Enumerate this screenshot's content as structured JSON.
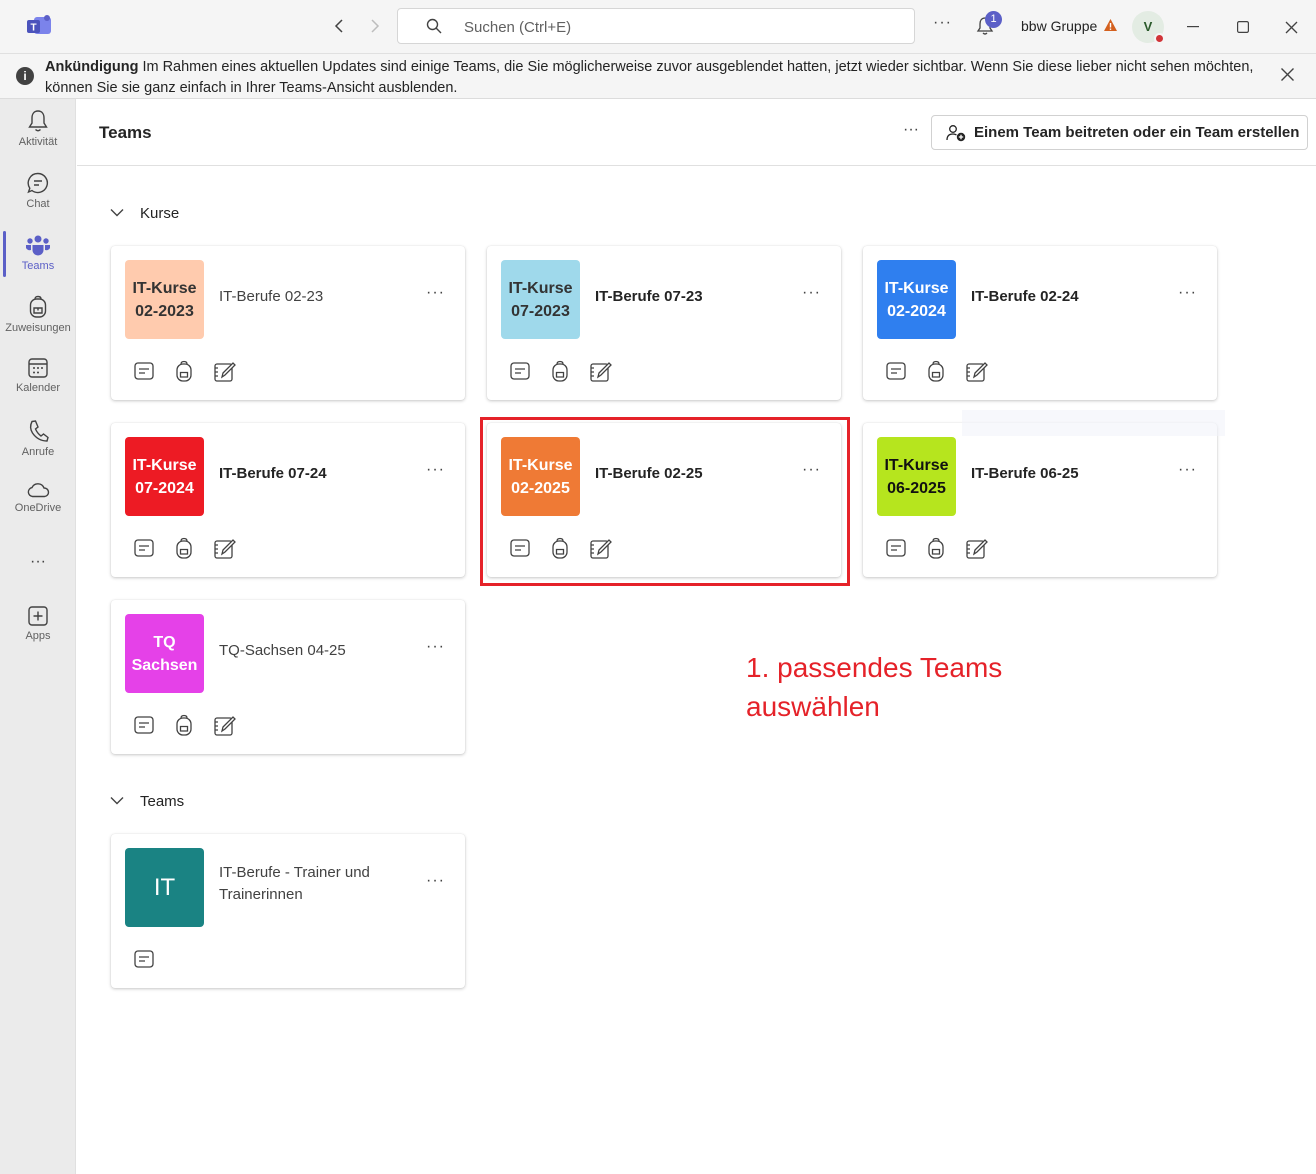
{
  "titlebar": {
    "search_placeholder": "Suchen (Ctrl+E)",
    "more": "···",
    "notification_count": "1",
    "org_name": "bbw Gruppe",
    "avatar_initial": "V"
  },
  "announcement": {
    "title": "Ankündigung",
    "text": " Im Rahmen eines aktuellen Updates sind einige Teams, die Sie möglicherweise zuvor ausgeblendet hatten, jetzt wieder sichtbar. Wenn Sie diese lieber nicht sehen möchten, können Sie sie ganz einfach in Ihrer Teams-Ansicht ausblenden."
  },
  "rail": {
    "items": [
      {
        "label": "Aktivität",
        "icon": "bell-icon"
      },
      {
        "label": "Chat",
        "icon": "chat-icon"
      },
      {
        "label": "Teams",
        "icon": "teams-icon"
      },
      {
        "label": "Zuweisungen",
        "icon": "backpack-icon"
      },
      {
        "label": "Kalender",
        "icon": "calendar-icon"
      },
      {
        "label": "Anrufe",
        "icon": "phone-icon"
      },
      {
        "label": "OneDrive",
        "icon": "cloud-icon"
      },
      {
        "label": "···",
        "icon": "more-icon"
      },
      {
        "label": "Apps",
        "icon": "add-app-icon"
      }
    ],
    "active": "Teams"
  },
  "header": {
    "title": "Teams",
    "more": "···",
    "join_button": "Einem Team beitreten oder ein Team erstellen"
  },
  "sections": [
    {
      "label": "Kurse"
    },
    {
      "label": "Teams"
    }
  ],
  "cards": [
    {
      "tile": "IT-Kurse\n02-2023",
      "name": "IT-Berufe 02-23",
      "tile_bg": "#ffcbae",
      "tile_fg": "#333333"
    },
    {
      "tile": "IT-Kurse\n07-2023",
      "name": "IT-Berufe 07-23",
      "tile_bg": "#9fd9eb",
      "tile_fg": "#333333"
    },
    {
      "tile": "IT-Kurse\n02-2024",
      "name": "IT-Berufe 02-24",
      "tile_bg": "#2f7fef",
      "tile_fg": "#ffffff"
    },
    {
      "tile": "IT-Kurse\n07-2024",
      "name": "IT-Berufe 07-24",
      "tile_bg": "#ed1b24",
      "tile_fg": "#ffffff"
    },
    {
      "tile": "IT-Kurse\n02-2025",
      "name": "IT-Berufe 02-25",
      "tile_bg": "#ef7a35",
      "tile_fg": "#ffffff"
    },
    {
      "tile": "IT-Kurse\n06-2025",
      "name": "IT-Berufe 06-25",
      "tile_bg": "#b6e51e",
      "tile_fg": "#111111"
    },
    {
      "tile": "TQ\nSachsen",
      "name": "TQ-Sachsen 04-25",
      "tile_bg": "#e541e8",
      "tile_fg": "#ffffff"
    },
    {
      "tile": "IT",
      "name": "IT-Berufe - Trainer und Trainerinnen",
      "tile_bg": "#1a8383",
      "tile_fg": "#ffffff"
    }
  ],
  "card_more": "···",
  "annotation": "1. passendes Teams\nauswählen",
  "colors": {
    "accent": "#5b5fc7",
    "highlight": "#e52229"
  }
}
